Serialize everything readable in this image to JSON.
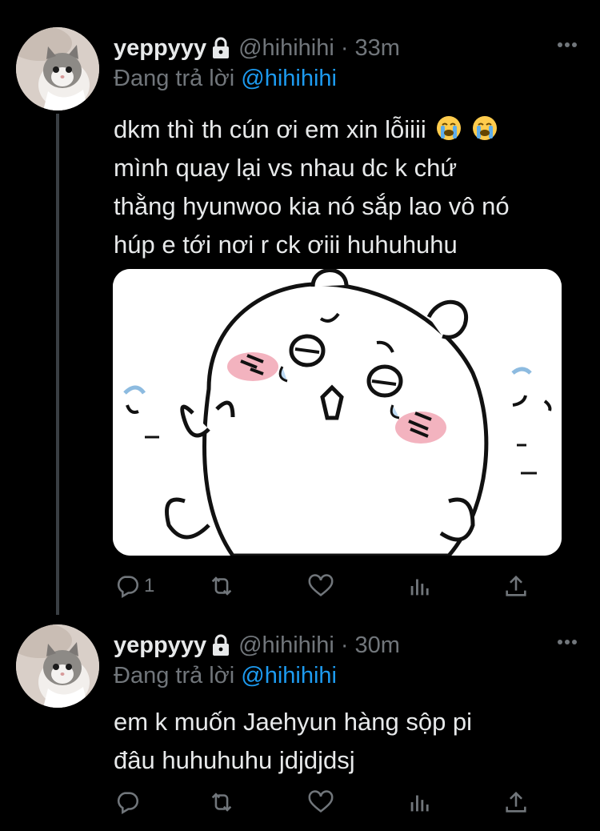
{
  "tweets": [
    {
      "display_name": "yeppyyy",
      "handle": "@hihihihi",
      "separator": "·",
      "time": "33m",
      "reply_prefix": "Đang trả lời",
      "reply_to": "@hihihihi",
      "lines": [
        "dkm thì th cún ơi em xin lỗiiii",
        "mình quay lại vs nhau dc k chứ",
        "thằng hyunwoo kia nó sắp lao vô nó",
        "húp e tới nơi r ck ơiii huhuhuhu"
      ],
      "emojis": [
        "loudly-crying-face",
        "loudly-crying-face"
      ],
      "media": "cartoon-sticker-image",
      "actions": {
        "reply_count": "1"
      }
    },
    {
      "display_name": "yeppyyy",
      "handle": "@hihihihi",
      "separator": "·",
      "time": "30m",
      "reply_prefix": "Đang trả lời",
      "reply_to": "@hihihihi",
      "lines": [
        "em k muốn Jaehyun hàng sộp pi",
        "đâu huhuhuhu jdjdjdsj"
      ]
    }
  ],
  "icons": [
    "lock-icon",
    "more-icon",
    "reply-icon",
    "retweet-icon",
    "like-icon",
    "analytics-icon",
    "share-icon"
  ],
  "colors": {
    "background": "#000000",
    "text": "#e7e9ea",
    "muted": "#71767b",
    "accent": "#1d9bf0"
  }
}
